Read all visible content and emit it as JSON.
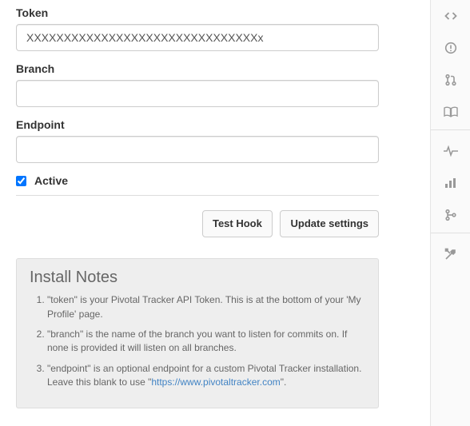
{
  "form": {
    "token": {
      "label": "Token",
      "value": "XXXXXXXXXXXXXXXXXXXXXXXXXXXXXXXx"
    },
    "branch": {
      "label": "Branch",
      "value": ""
    },
    "endpoint": {
      "label": "Endpoint",
      "value": ""
    },
    "active": {
      "label": "Active",
      "checked": true
    },
    "buttons": {
      "test": "Test Hook",
      "update": "Update settings"
    }
  },
  "install_notes": {
    "title": "Install Notes",
    "items": [
      {
        "pre": "\"token\" is your Pivotal Tracker API Token. This is at the bottom of your 'My Profile' page."
      },
      {
        "pre": "\"branch\" is the name of the branch you want to listen for commits on. If none is provided it will listen on all branches."
      },
      {
        "pre": "\"endpoint\" is an optional endpoint for a custom Pivotal Tracker installation. Leave this blank to use \"",
        "link": "https://www.pivotaltracker.com",
        "post": "\"."
      }
    ]
  }
}
